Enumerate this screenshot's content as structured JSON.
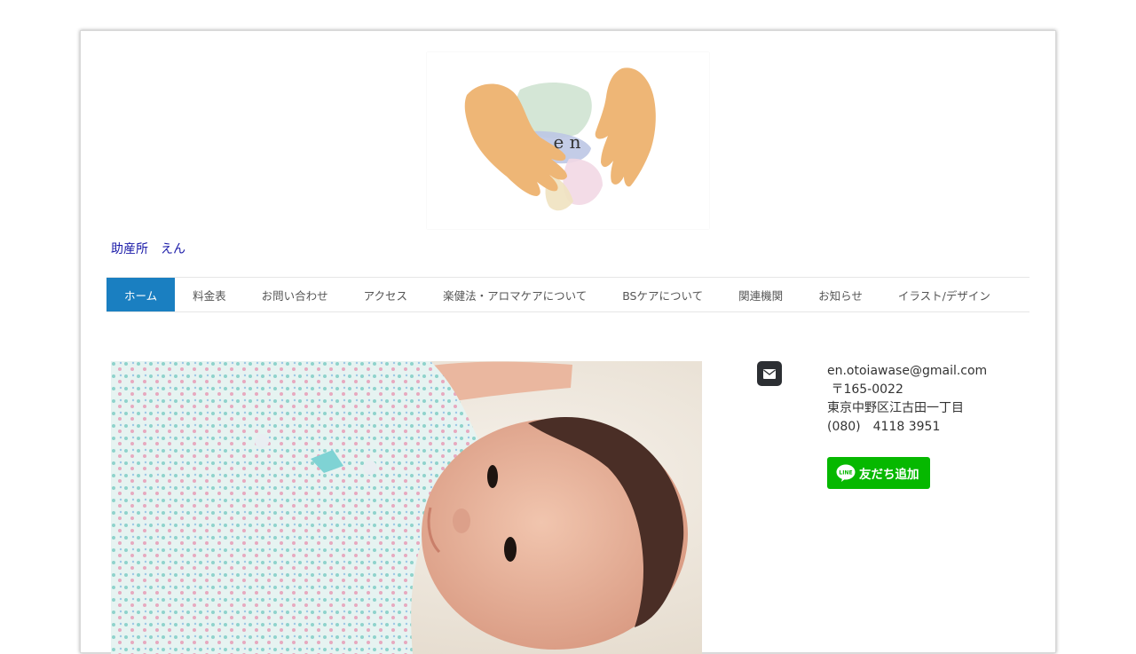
{
  "logo": {
    "text": "e n"
  },
  "site_title": "助産所　えん",
  "nav": {
    "items": [
      {
        "label": "ホーム",
        "active": true
      },
      {
        "label": "料金表"
      },
      {
        "label": "お問い合わせ"
      },
      {
        "label": "アクセス"
      },
      {
        "label": "楽健法・アロマケアについて"
      },
      {
        "label": "BSケアについて"
      },
      {
        "label": "関連機関"
      },
      {
        "label": "お知らせ"
      },
      {
        "label": "イラスト/デザイン"
      }
    ]
  },
  "contact": {
    "icon": "mail-icon",
    "email": "en.otoiawase@gmail.com",
    "postal": " 〒165-0022",
    "address": "東京中野区江古田一丁目",
    "phone": "(080)　4118 3951"
  },
  "line_button": {
    "label": "友だち追加",
    "logo_text": "LINE"
  },
  "colors": {
    "nav_active": "#1a7fc1",
    "line_green": "#06b800",
    "title_link": "#1a1aa8"
  }
}
